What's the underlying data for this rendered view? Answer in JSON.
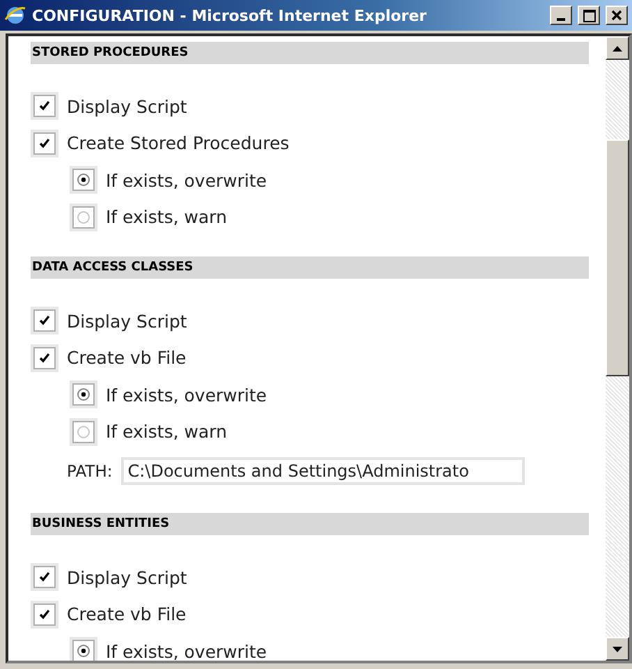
{
  "window": {
    "title": "CONFIGURATION - Microsoft Internet Explorer"
  },
  "sections": [
    {
      "title": "STORED PROCEDURES",
      "items": [
        {
          "kind": "checkbox",
          "label": "Display Script",
          "checked": true
        },
        {
          "kind": "checkbox",
          "label": "Create Stored Procedures",
          "checked": true
        },
        {
          "kind": "radio",
          "label": "If exists, overwrite",
          "selected": true
        },
        {
          "kind": "radio",
          "label": "If exists, warn",
          "selected": false
        }
      ]
    },
    {
      "title": "DATA ACCESS CLASSES",
      "items": [
        {
          "kind": "checkbox",
          "label": "Display Script",
          "checked": true
        },
        {
          "kind": "checkbox",
          "label": "Create vb File",
          "checked": true
        },
        {
          "kind": "radio",
          "label": "If exists, overwrite",
          "selected": true
        },
        {
          "kind": "radio",
          "label": "If exists, warn",
          "selected": false
        },
        {
          "kind": "path",
          "label": "PATH:",
          "value": "C:\\Documents and Settings\\Administrato"
        }
      ]
    },
    {
      "title": "BUSINESS ENTITIES",
      "items": [
        {
          "kind": "checkbox",
          "label": "Display Script",
          "checked": true
        },
        {
          "kind": "checkbox",
          "label": "Create vb File",
          "checked": true
        },
        {
          "kind": "radio",
          "label": "If exists, overwrite",
          "selected": true
        }
      ]
    }
  ]
}
